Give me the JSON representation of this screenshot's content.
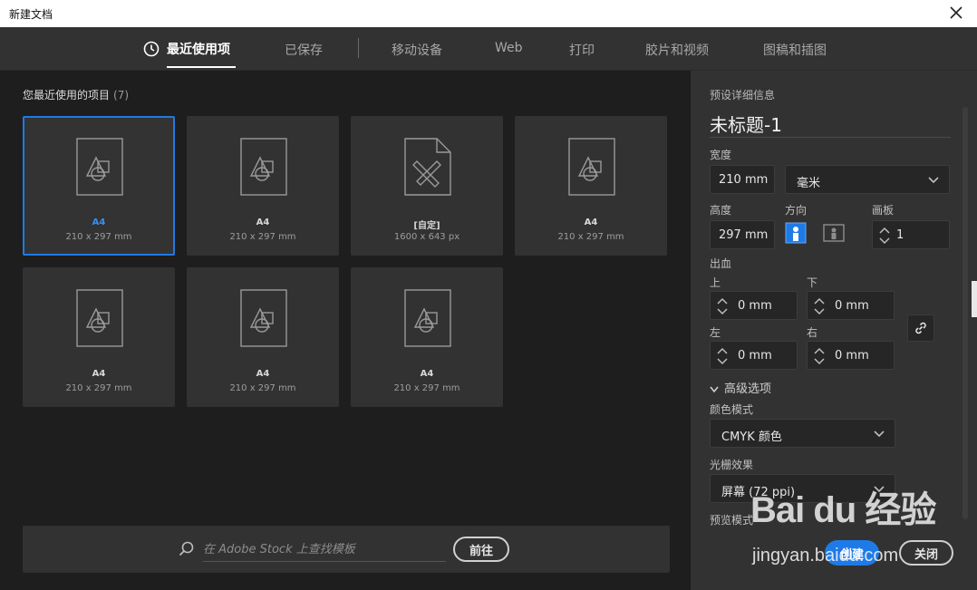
{
  "window": {
    "title": "新建文档"
  },
  "tabs": [
    {
      "label": "最近使用项",
      "active": true
    },
    {
      "label": "已保存"
    },
    {
      "label": "移动设备"
    },
    {
      "label": "Web"
    },
    {
      "label": "打印"
    },
    {
      "label": "胶片和视频"
    },
    {
      "label": "图稿和插图"
    }
  ],
  "recent": {
    "title": "您最近使用的项目",
    "count": "(7)",
    "items": [
      {
        "name": "A4",
        "size": "210 x 297 mm",
        "icon": "document-shapes-icon",
        "selected": true
      },
      {
        "name": "A4",
        "size": "210 x 297 mm",
        "icon": "document-shapes-icon"
      },
      {
        "name": "[自定]",
        "size": "1600 x 643 px",
        "icon": "document-ruler-pencil-icon"
      },
      {
        "name": "A4",
        "size": "210 x 297 mm",
        "icon": "document-shapes-icon"
      },
      {
        "name": "A4",
        "size": "210 x 297 mm",
        "icon": "document-shapes-icon"
      },
      {
        "name": "A4",
        "size": "210 x 297 mm",
        "icon": "document-shapes-icon"
      },
      {
        "name": "A4",
        "size": "210 x 297 mm",
        "icon": "document-shapes-icon"
      }
    ]
  },
  "search": {
    "placeholder": "在 Adobe Stock 上查找模板",
    "go_label": "前往"
  },
  "preset": {
    "header": "预设详细信息",
    "doc_title": "未标题-1",
    "width_label": "宽度",
    "width_value": "210 mm",
    "unit_value": "毫米",
    "height_label": "高度",
    "height_value": "297 mm",
    "orientation_label": "方向",
    "artboards_label": "画板",
    "artboards_value": "1",
    "bleed_label": "出血",
    "bleed_top_label": "上",
    "bleed_top_value": "0 mm",
    "bleed_bottom_label": "下",
    "bleed_bottom_value": "0 mm",
    "bleed_left_label": "左",
    "bleed_left_value": "0 mm",
    "bleed_right_label": "右",
    "bleed_right_value": "0 mm",
    "advanced_label": "高级选项",
    "color_mode_label": "颜色模式",
    "color_mode_value": "CMYK 颜色",
    "raster_label": "光栅效果",
    "raster_value": "屏幕 (72 ppi)",
    "preview_label": "预览模式",
    "create_label": "创建",
    "close_label": "关闭"
  },
  "watermark": {
    "main": "Bai du 经验",
    "sub": "jingyan.baidu.com"
  },
  "colors": {
    "accent": "#1e7ae6",
    "panel": "#323232",
    "background": "#1e1e1e"
  }
}
